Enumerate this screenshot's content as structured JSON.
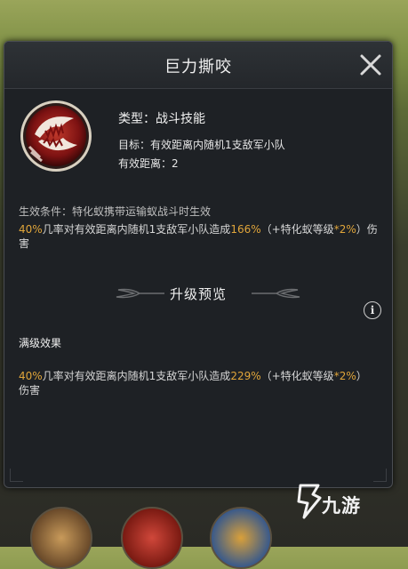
{
  "dialog": {
    "title": "巨力撕咬"
  },
  "skill": {
    "icon": "biting-jaws-icon",
    "type_label": "类型：战斗技能",
    "target_label": "目标：有效距离内随机1支敌军小队",
    "range_label": "有效距离：2",
    "condition": "生效条件：特化蚁携带运输蚁战斗时生效",
    "effect": {
      "p1": "40%",
      "p2": "几率对有效距离内随机1支敌军小队造成",
      "p3": "166%",
      "p4": "（+特化蚁等级",
      "p5": "*2%",
      "p6": "）伤害"
    }
  },
  "upgrade": {
    "title": "升级预览",
    "info_icon_text": "i",
    "max_label": "满级效果",
    "max_effect": {
      "p1": "40%",
      "p2": "几率对有效距离内随机1支敌军小队造成",
      "p3": "229%",
      "p4": "（+特化蚁等级",
      "p5": "*2%",
      "p6": "）伤害"
    }
  },
  "watermark": {
    "text": "九游",
    "icon": "jiuyou-logo-icon"
  },
  "colors": {
    "highlight": "#e0a53a",
    "panel_bg": "#1e2125"
  }
}
